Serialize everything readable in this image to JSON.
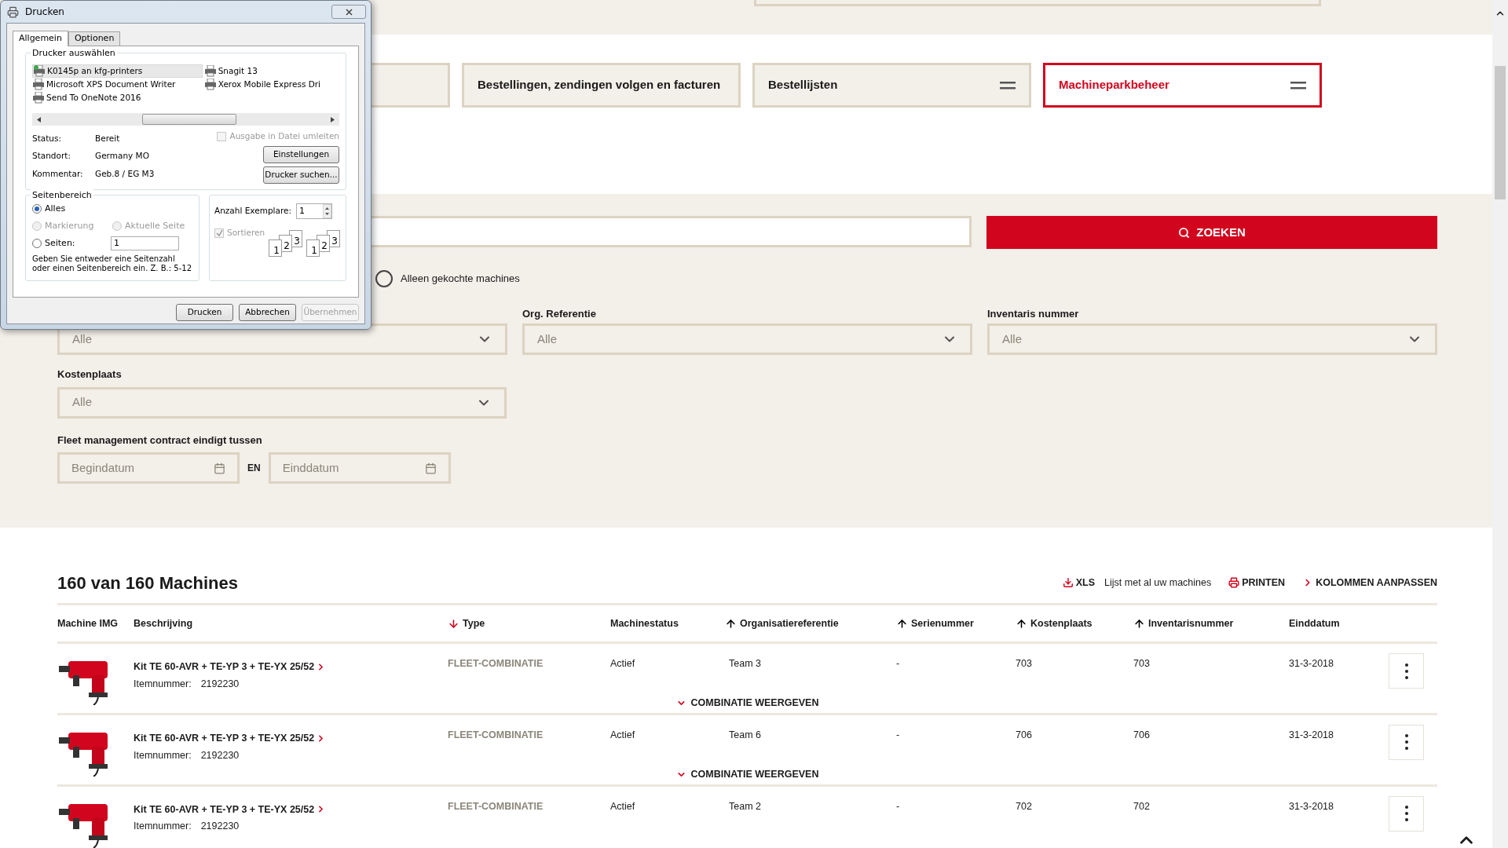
{
  "nav_tiles": [
    {
      "label": "Bestellingen, zendingen volgen en facturen",
      "selected": false,
      "menu": false
    },
    {
      "label": "Bestellijsten",
      "selected": false,
      "menu": true
    },
    {
      "label": "Machineparkbeheer",
      "selected": true,
      "menu": true
    }
  ],
  "search": {
    "button": "ZOEKEN"
  },
  "only_bought": {
    "label": "Alleen gekochte machines",
    "checked": false
  },
  "filters": [
    {
      "value": "Alle"
    },
    {
      "label": "Org. Referentie",
      "value": "Alle"
    },
    {
      "label": "Inventaris nummer",
      "value": "Alle"
    },
    {
      "label": "Kostenplaats",
      "value": "Alle"
    }
  ],
  "date_filter": {
    "label": "Fleet management contract eindigt tussen",
    "from_placeholder": "Begindatum",
    "joiner": "EN",
    "to_placeholder": "Einddatum"
  },
  "results": {
    "title": "160 van 160 Machines",
    "actions": [
      {
        "kind": "xls",
        "label": "XLS",
        "note": "Lijst met al uw machines"
      },
      {
        "kind": "print",
        "label": "PRINTEN"
      },
      {
        "kind": "columns",
        "label": "KOLOMMEN AANPASSEN"
      }
    ]
  },
  "table": {
    "columns": [
      {
        "label": "Machine IMG",
        "sorted": false
      },
      {
        "label": "Beschrijving",
        "sorted": false
      },
      {
        "label": "Type",
        "sorted": true,
        "descending": true
      },
      {
        "label": "Machinestatus",
        "sorted": false
      },
      {
        "label": "Organisatiereferentie",
        "sorted": true,
        "descending": false
      },
      {
        "label": "Serienummer",
        "sorted": true,
        "descending": false
      },
      {
        "label": "Kostenplaats",
        "sorted": true,
        "descending": false
      },
      {
        "label": "Inventarisnummer",
        "sorted": true,
        "descending": false
      },
      {
        "label": "Einddatum",
        "sorted": false
      }
    ],
    "rows": [
      {
        "description": "Kit TE 60-AVR + TE-YP 3 + TE-YX 25/52",
        "item_label": "Itemnummer:",
        "item_number": "2192230",
        "type": "FLEET-COMBINATIE",
        "status": "Actief",
        "org_ref": "Team 3",
        "serial": "-",
        "cost_center": "703",
        "inventory": "703",
        "end_date": "31-3-2018",
        "expand": "COMBINATIE WEERGEVEN"
      },
      {
        "description": "Kit TE 60-AVR + TE-YP 3 + TE-YX 25/52",
        "item_label": "Itemnummer:",
        "item_number": "2192230",
        "type": "FLEET-COMBINATIE",
        "status": "Actief",
        "org_ref": "Team 6",
        "serial": "-",
        "cost_center": "706",
        "inventory": "706",
        "end_date": "31-3-2018",
        "expand": "COMBINATIE WEERGEVEN"
      },
      {
        "description": "Kit TE 60-AVR + TE-YP 3 + TE-YX 25/52",
        "item_label": "Itemnummer:",
        "item_number": "2192230",
        "type": "FLEET-COMBINATIE",
        "status": "Actief",
        "org_ref": "Team 2",
        "serial": "-",
        "cost_center": "702",
        "inventory": "702",
        "end_date": "31-3-2018"
      }
    ]
  },
  "print_dialog": {
    "title": "Drucken",
    "tabs": [
      {
        "label": "Allgemein",
        "selected": true
      },
      {
        "label": "Optionen",
        "selected": false
      }
    ],
    "printer_group": "Drucker auswählen",
    "printers": [
      {
        "name": "K0145p an kfg-printers",
        "selected": true
      },
      {
        "name": "Microsoft XPS Document Writer",
        "selected": false
      },
      {
        "name": "Send To OneNote 2016",
        "selected": false
      },
      {
        "name": "Snagit 13",
        "selected": false
      },
      {
        "name": "Xerox Mobile Express Dri",
        "selected": false
      }
    ],
    "info": [
      {
        "label": "Status:",
        "value": "Bereit"
      },
      {
        "label": "Standort:",
        "value": "Germany MO"
      },
      {
        "label": "Kommentar:",
        "value": "Geb.8 / EG M3"
      }
    ],
    "redirect": {
      "label": "Ausgabe in Datei umleiten",
      "checked": false,
      "disabled": true
    },
    "side_buttons": [
      "Einstellungen",
      "Drucker suchen..."
    ],
    "range": {
      "title": "Seitenbereich",
      "options": [
        {
          "label": "Alles",
          "selected": true,
          "disabled": false
        },
        {
          "label": "Markierung",
          "selected": false,
          "disabled": true
        },
        {
          "label": "Aktuelle Seite",
          "selected": false,
          "disabled": true
        },
        {
          "label": "Seiten:",
          "selected": false,
          "disabled": false
        }
      ],
      "pages_value": "1",
      "hint": "Geben Sie entweder eine Seitenzahl oder einen Seitenbereich ein. Z. B.: 5-12"
    },
    "copies": {
      "label": "Anzahl Exemplare:",
      "value": "1",
      "collate": {
        "label": "Sortieren",
        "checked": true,
        "disabled": true
      },
      "stacks": [
        [
          "1",
          "2",
          "3"
        ],
        [
          "1",
          "2",
          "3"
        ]
      ]
    },
    "buttons": [
      {
        "label": "Drucken",
        "disabled": false
      },
      {
        "label": "Abbrechen",
        "disabled": false
      },
      {
        "label": "Übernehmen",
        "disabled": true
      }
    ]
  }
}
